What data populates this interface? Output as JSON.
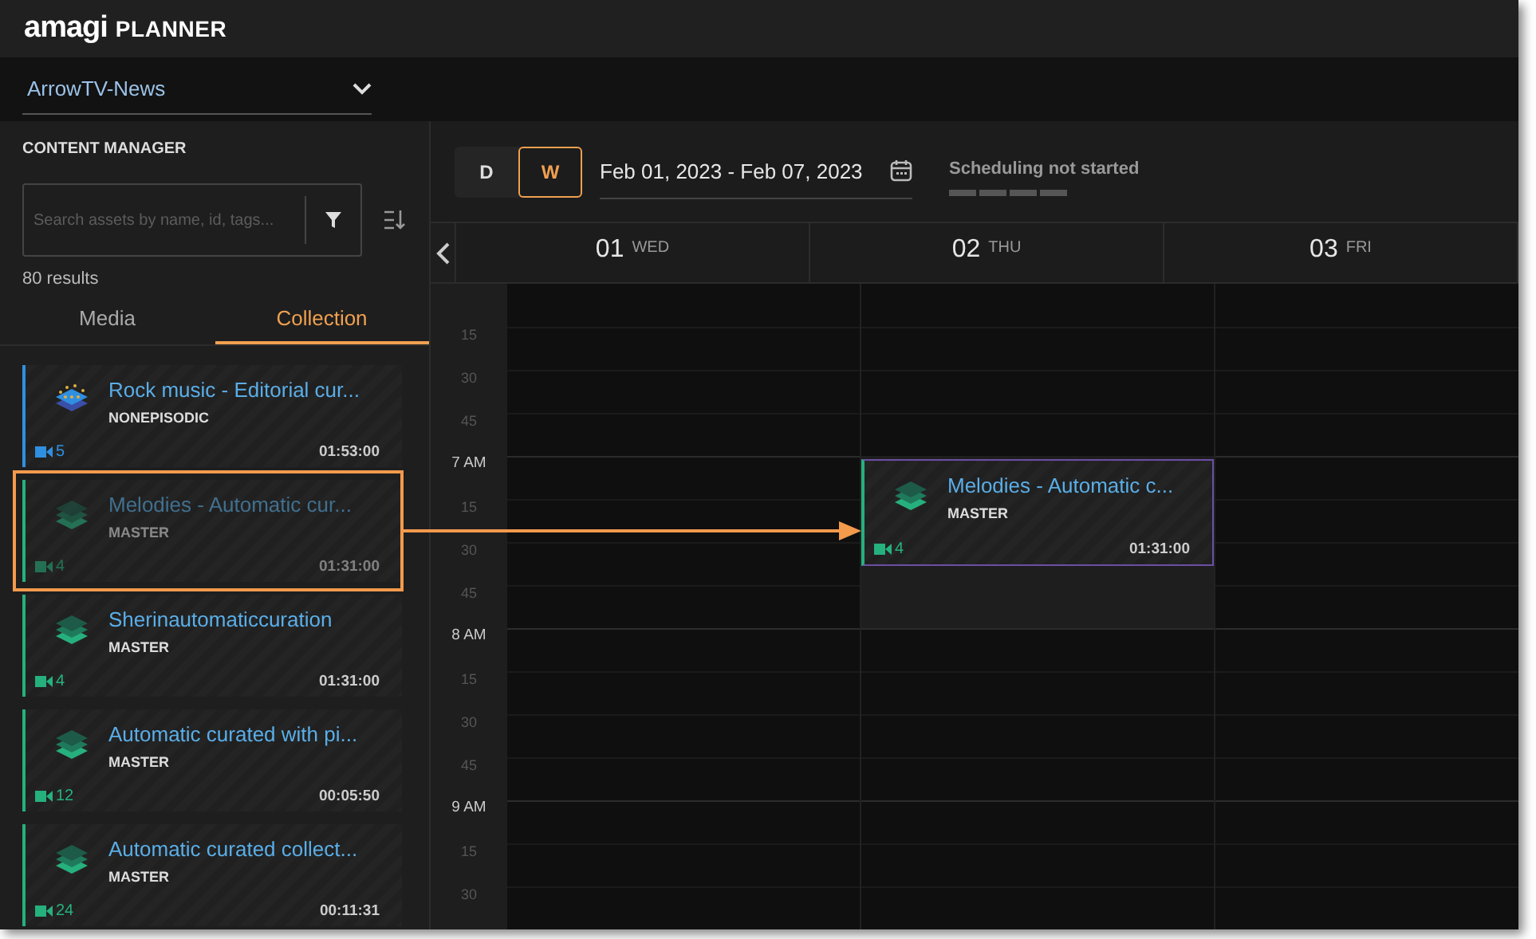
{
  "app": {
    "logo": "amagi",
    "title": "PLANNER"
  },
  "channel": {
    "value": "ArrowTV-News"
  },
  "content_manager": {
    "title": "CONTENT MANAGER",
    "search": {
      "placeholder": "Search assets by name, id, tags..."
    },
    "results": "80 results",
    "tabs": [
      {
        "label": "Media",
        "selected": false
      },
      {
        "label": "Collection",
        "selected": true
      }
    ],
    "items": [
      {
        "title": "Rock music - Editorial cur...",
        "type": "NONEPISODIC",
        "count": "5",
        "duration": "01:53:00",
        "color": "#2f8fe0",
        "kind": "dotted",
        "dragging": false
      },
      {
        "title": "Melodies - Automatic cur...",
        "type": "MASTER",
        "count": "4",
        "duration": "01:31:00",
        "color": "#26b07e",
        "kind": "layers",
        "dragging": true
      },
      {
        "title": "Sherinautomaticcuration",
        "type": "MASTER",
        "count": "4",
        "duration": "01:31:00",
        "color": "#26b07e",
        "kind": "layers",
        "dragging": false
      },
      {
        "title": "Automatic curated with pi...",
        "type": "MASTER",
        "count": "12",
        "duration": "00:05:50",
        "color": "#26b07e",
        "kind": "layers",
        "dragging": false
      },
      {
        "title": "Automatic curated collect...",
        "type": "MASTER",
        "count": "24",
        "duration": "00:11:31",
        "color": "#26b07e",
        "kind": "layers",
        "dragging": false
      }
    ]
  },
  "toolbar": {
    "views": [
      {
        "label": "D",
        "selected": false
      },
      {
        "label": "W",
        "selected": true
      }
    ],
    "date_range": "Feb 01, 2023 - Feb 07, 2023",
    "status": "Scheduling not started",
    "progress": {
      "level": 0
    }
  },
  "calendar": {
    "days": [
      {
        "number": "01",
        "weekday": "WED"
      },
      {
        "number": "02",
        "weekday": "THU",
        "events": [
          {
            "title": "Melodies - Automatic c...",
            "type": "MASTER",
            "count": "4",
            "duration": "01:31:00",
            "color": "#26b07e"
          }
        ]
      },
      {
        "number": "03",
        "weekday": "FRI"
      }
    ],
    "slots": [
      {
        "label": "15",
        "hour": false
      },
      {
        "label": "30",
        "hour": false
      },
      {
        "label": "45",
        "hour": false
      },
      {
        "label": "7 AM",
        "hour": true,
        "event_start": true
      },
      {
        "label": "15",
        "hour": false
      },
      {
        "label": "30",
        "hour": false
      },
      {
        "label": "45",
        "hour": false
      },
      {
        "label": "8 AM",
        "hour": true
      },
      {
        "label": "15",
        "hour": false
      },
      {
        "label": "30",
        "hour": false
      },
      {
        "label": "45",
        "hour": false
      },
      {
        "label": "9 AM",
        "hour": true
      },
      {
        "label": "15",
        "hour": false
      },
      {
        "label": "30",
        "hour": false
      }
    ]
  }
}
